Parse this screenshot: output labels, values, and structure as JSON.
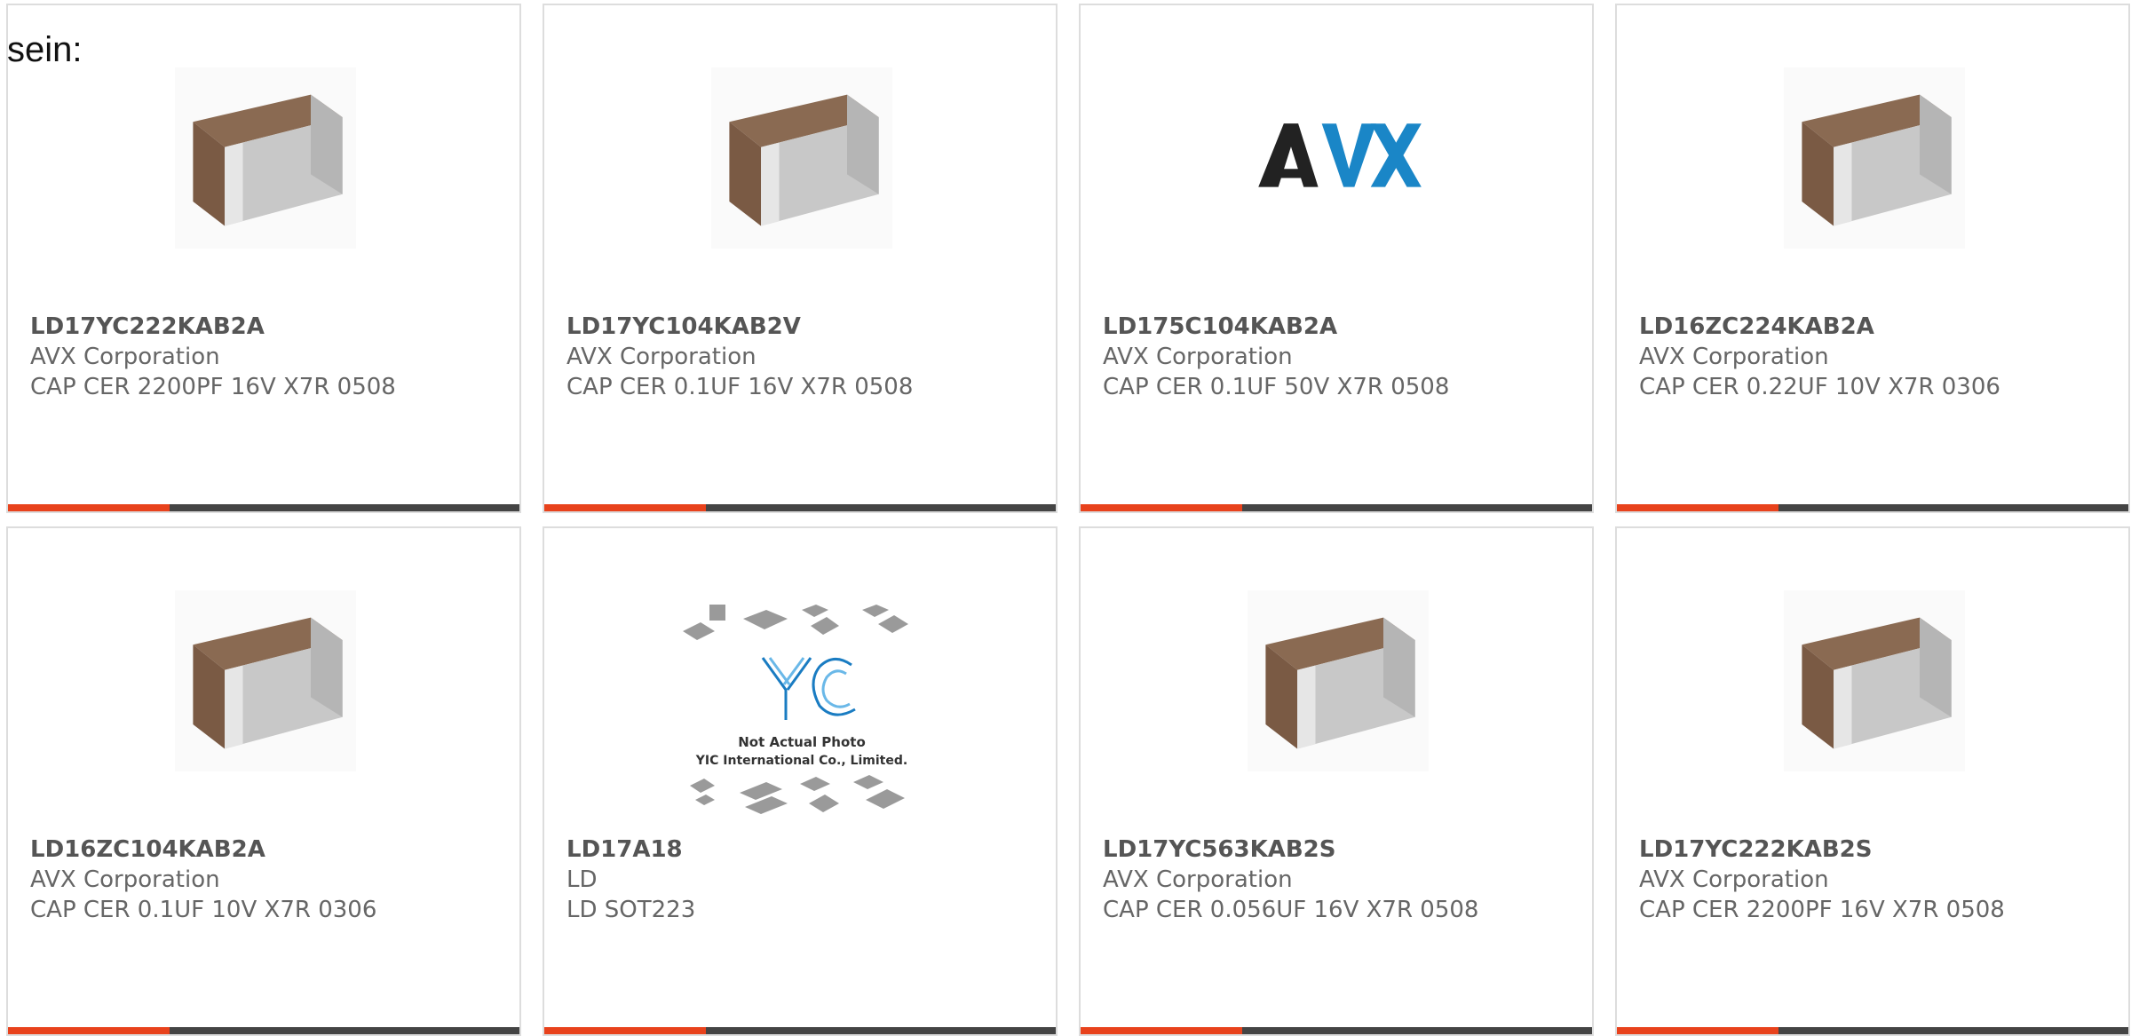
{
  "intro_text": "sein:",
  "colors": {
    "accent": "#e8421c",
    "bar": "#444444",
    "border": "#dddddd",
    "text": "#666666"
  },
  "products": [
    {
      "part_number": "LD17YC222KAB2A",
      "manufacturer": "AVX Corporation",
      "description": "CAP CER 2200PF 16V X7R 0508",
      "image": "capacitor-chip-image"
    },
    {
      "part_number": "LD17YC104KAB2V",
      "manufacturer": "AVX Corporation",
      "description": "CAP CER 0.1UF 16V X7R 0508",
      "image": "capacitor-chip-image"
    },
    {
      "part_number": "LD175C104KAB2A",
      "manufacturer": "AVX Corporation",
      "description": "CAP CER 0.1UF 50V X7R 0508",
      "image": "avx-logo",
      "logo_text": "AVX"
    },
    {
      "part_number": "LD16ZC224KAB2A",
      "manufacturer": "AVX Corporation",
      "description": "CAP CER 0.22UF 10V X7R 0306",
      "image": "capacitor-chip-image"
    },
    {
      "part_number": "LD16ZC104KAB2A",
      "manufacturer": "AVX Corporation",
      "description": "CAP CER 0.1UF 10V X7R 0306",
      "image": "capacitor-chip-image"
    },
    {
      "part_number": "LD17A18",
      "manufacturer": "LD",
      "description": "LD SOT223",
      "image": "yic-not-actual-photo",
      "logo_text": "YIC",
      "photo_note_line1": "Not Actual Photo",
      "photo_note_line2": "YIC International Co., Limited."
    },
    {
      "part_number": "LD17YC563KAB2S",
      "manufacturer": "AVX Corporation",
      "description": "CAP CER 0.056UF 16V X7R 0508",
      "image": "capacitor-chip-image"
    },
    {
      "part_number": "LD17YC222KAB2S",
      "manufacturer": "AVX Corporation",
      "description": "CAP CER 2200PF 16V X7R 0508",
      "image": "capacitor-chip-image"
    }
  ]
}
